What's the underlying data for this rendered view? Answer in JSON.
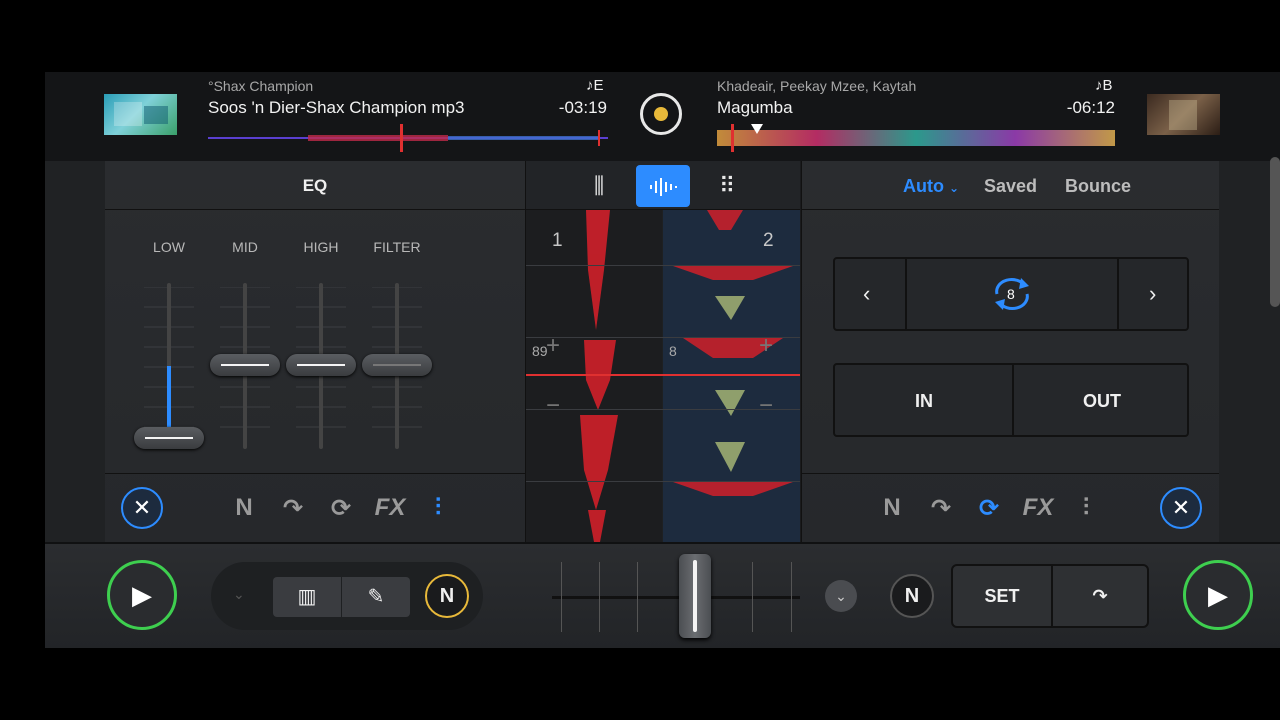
{
  "deck_a": {
    "artist": "°Shax Champion",
    "title": "Soos 'n Dier-Shax Champion mp3",
    "time": "-03:19",
    "key": "♪E"
  },
  "deck_b": {
    "artist": "Khadeair,  Peekay Mzee,  Kaytah",
    "title": "Magumba",
    "time": "-06:12",
    "key": "♪B"
  },
  "eq_panel": {
    "title": "EQ",
    "labels": [
      "LOW",
      "MID",
      "HIGH",
      "FILTER"
    ]
  },
  "center_panel": {
    "tools": [
      "mixer-icon",
      "waveform-icon",
      "grid-icon"
    ],
    "lane_a_number": "1",
    "lane_b_number": "2",
    "lane_a_bpm": "89",
    "lane_b_bpm": "8"
  },
  "loop_panel": {
    "tab_auto": "Auto",
    "tab_saved": "Saved",
    "tab_bounce": "Bounce",
    "loop_value": "8",
    "in_label": "IN",
    "out_label": "OUT"
  },
  "footer_icons": {
    "fx": "FX"
  },
  "bottom_bar": {
    "set_label": "SET",
    "crossfader_level": 0.57
  },
  "colors": {
    "accent": "#2d8cff",
    "play_ring": "#3ecf4f",
    "record_dot": "#e8b93a",
    "wave_red": "#e03030"
  }
}
